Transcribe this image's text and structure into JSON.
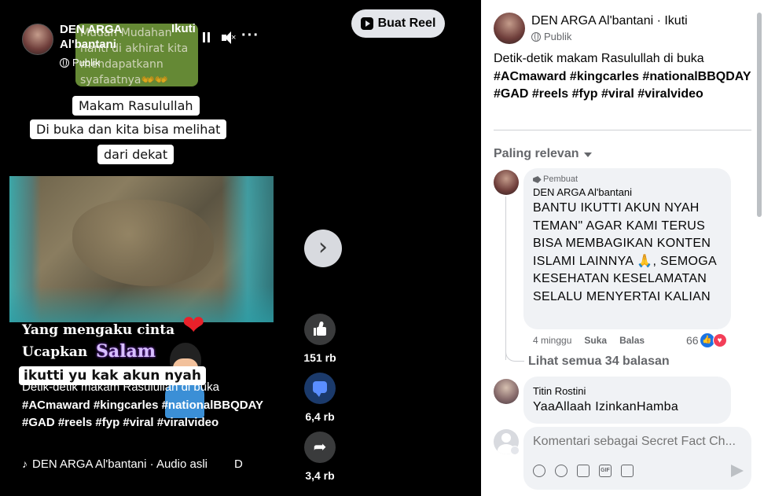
{
  "video": {
    "author_name": "DEN ARGA Al'bantani",
    "follow_label": "Ikuti",
    "privacy": "Publik",
    "green_caption": [
      "Mudah Mudahan",
      "nanti di akhirat kita",
      "mendapatkann",
      "syafaatnya👐👐"
    ],
    "white_caption": [
      "Makam Rasulullah",
      "Di buka dan kita bisa melihat",
      "dari dekat"
    ],
    "overlay_line1": "Yang mengaku cinta",
    "overlay_line2": "Ucapkan",
    "overlay_salam": "Salam",
    "overlay_akun": "ikutti yu kak akun nyah",
    "caption_text": "Detik-detik makam Rasulullah di buka",
    "caption_tags": "#ACmaward #kingcarles #nationalBBQDAY #GAD #reels #fyp #viral #viralvideo",
    "audio_label": "DEN ARGA Al'bantani · Audio asli",
    "audio_tail": "D"
  },
  "actions": {
    "likes": "151 rb",
    "comments": "6,4 rb",
    "shares": "3,4 rb"
  },
  "create_reel_label": "Buat Reel",
  "panel": {
    "author_line": "DEN ARGA Al'bantani · Ikuti",
    "privacy": "Publik",
    "desc_text": "Detik-detik makam Rasulullah di buka",
    "desc_tags": "#ACmaward #kingcarles #nationalBBQDAY #GAD #reels #fyp #viral #viralvideo",
    "sort_label": "Paling relevan",
    "comments": [
      {
        "badge": "Pembuat",
        "name": "DEN ARGA Al'bantani",
        "text": "BANTU IKUTTI AKUN NYAH TEMAN\" AGAR KAMI TERUS BISA MEMBAGIKAN KONTEN ISLAMI LAINNYA 🙏, SEMOGA KESEHATAN KESELAMATAN SELALU MENYERTAI KALIAN",
        "time": "4 minggu",
        "like": "Suka",
        "reply": "Balas",
        "reactions": "66"
      },
      {
        "name": "Titin Rostini",
        "text": "YaaAllaah IzinkanHamba"
      }
    ],
    "see_replies": "Lihat semua 34 balasan",
    "composer_placeholder": "Komentari sebagai Secret Fact Ch..."
  },
  "colors": {
    "accent": "#1b74e4",
    "love": "#f33e58",
    "muted": "#65676b"
  }
}
